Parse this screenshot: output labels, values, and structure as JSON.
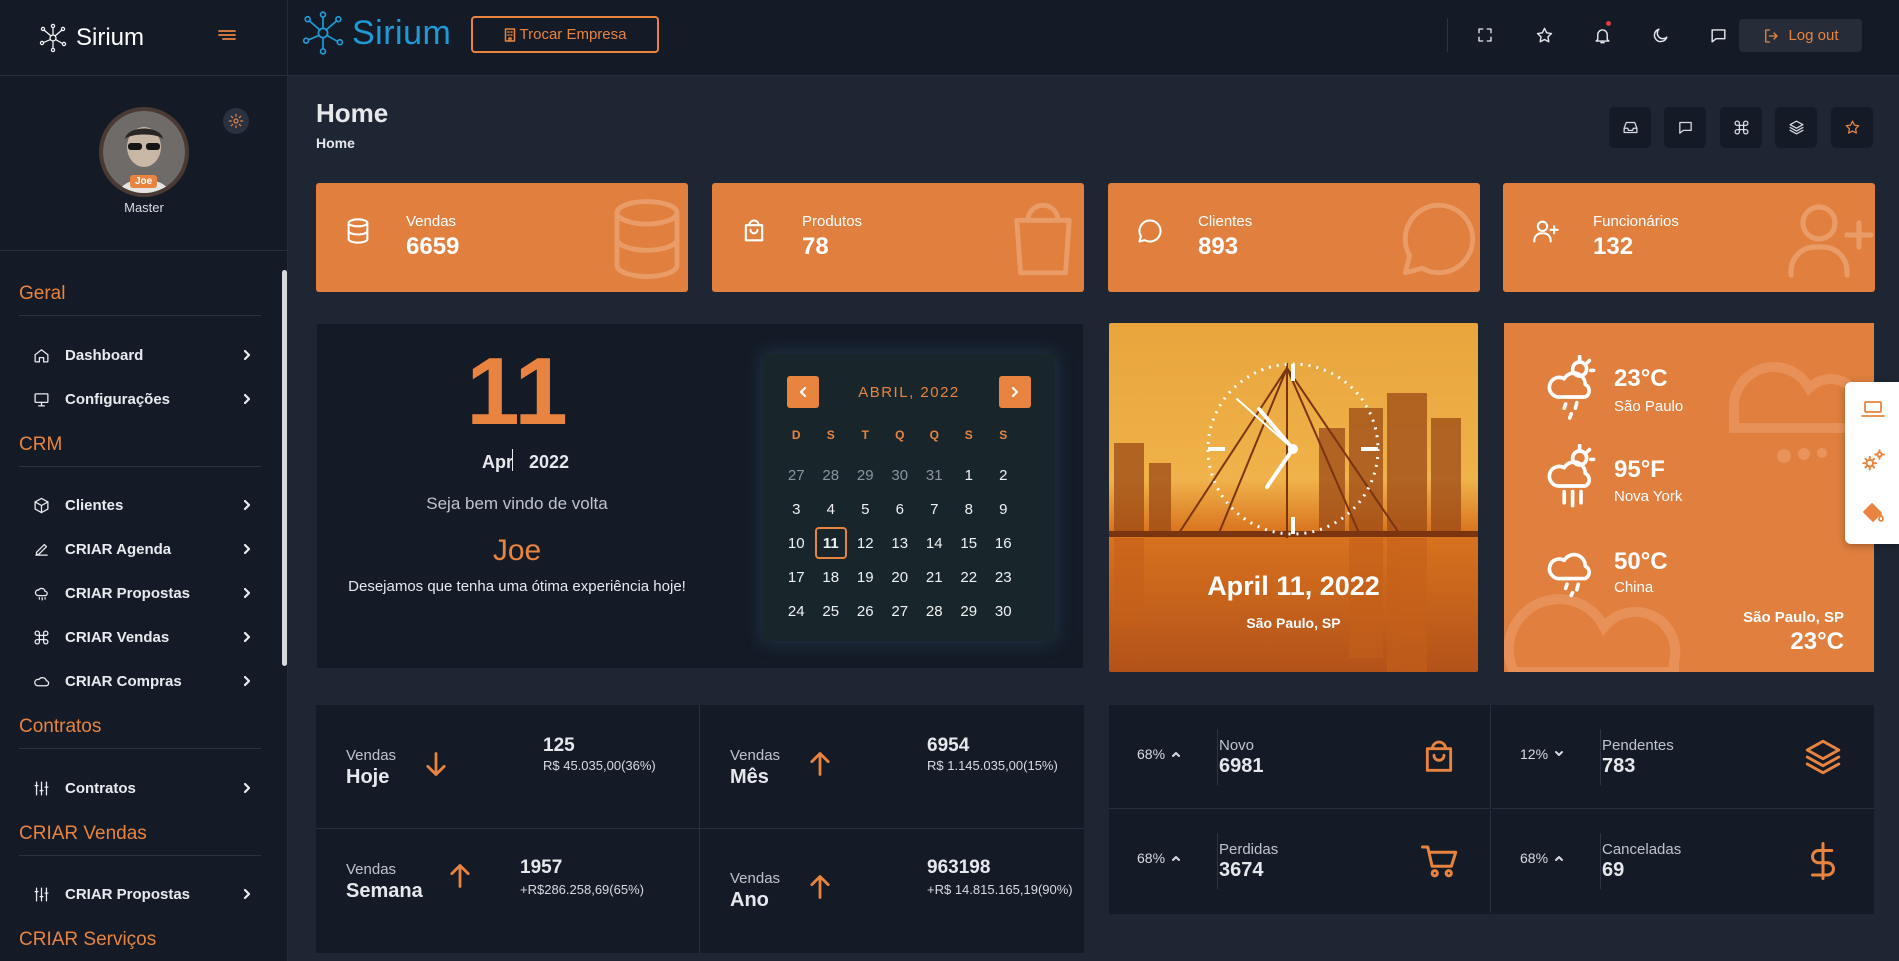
{
  "sidebar": {
    "brand": "Sirium",
    "profile": {
      "badge": "Joe",
      "role": "Master"
    },
    "sections": [
      {
        "title": "Geral",
        "items": [
          {
            "label": "Dashboard"
          },
          {
            "label": "Configurações"
          }
        ]
      },
      {
        "title": "CRM",
        "items": [
          {
            "label": "Clientes"
          },
          {
            "label": "CRIAR Agenda"
          },
          {
            "label": "CRIAR Propostas"
          },
          {
            "label": "CRIAR Vendas"
          },
          {
            "label": "CRIAR Compras"
          }
        ]
      },
      {
        "title": "Contratos",
        "items": [
          {
            "label": "Contratos"
          }
        ]
      },
      {
        "title": "CRIAR Vendas",
        "items": [
          {
            "label": "CRIAR Propostas"
          }
        ]
      },
      {
        "title": "CRIAR Serviços",
        "items": []
      }
    ]
  },
  "topbar": {
    "brand": "Sirium",
    "switch_company": "Trocar Empresa",
    "logout": "Log out",
    "icons": [
      "fullscreen-icon",
      "star-icon",
      "bell-icon",
      "moon-icon",
      "chat-icon"
    ]
  },
  "page": {
    "title": "Home",
    "breadcrumb": "Home"
  },
  "stats": [
    {
      "label": "Vendas",
      "value": "6659",
      "icon": "database-icon"
    },
    {
      "label": "Produtos",
      "value": "78",
      "icon": "shopping-bag-icon"
    },
    {
      "label": "Clientes",
      "value": "893",
      "icon": "chat-bubble-icon"
    },
    {
      "label": "Funcionários",
      "value": "132",
      "icon": "user-plus-icon"
    }
  ],
  "welcome": {
    "day": "11",
    "month": "Apr",
    "year": "2022",
    "greeting": "Seja bem vindo de volta",
    "name": "Joe",
    "message": "Desejamos que tenha uma ótima experiência hoje!"
  },
  "calendar": {
    "title": "ABRIL, 2022",
    "dow": [
      "D",
      "S",
      "T",
      "Q",
      "Q",
      "S",
      "S"
    ],
    "days": [
      [
        "27",
        "28",
        "29",
        "30",
        "31",
        "1",
        "2"
      ],
      [
        "3",
        "4",
        "5",
        "6",
        "7",
        "8",
        "9"
      ],
      [
        "10",
        "11",
        "12",
        "13",
        "14",
        "15",
        "16"
      ],
      [
        "17",
        "18",
        "19",
        "20",
        "21",
        "22",
        "23"
      ],
      [
        "24",
        "25",
        "26",
        "27",
        "28",
        "29",
        "30"
      ]
    ],
    "muted": [
      "27",
      "28",
      "29",
      "30",
      "31"
    ],
    "today": "11"
  },
  "city_card": {
    "date": "April 11, 2022",
    "location": "São Paulo, SP"
  },
  "weather": {
    "items": [
      {
        "temp": "23°C",
        "city": "São Paulo"
      },
      {
        "temp": "95°F",
        "city": "Nova York"
      },
      {
        "temp": "50°C",
        "city": "China"
      }
    ],
    "current_location": "São Paulo, SP",
    "current_temp": "23°C"
  },
  "sales": [
    {
      "kicker": "Vendas",
      "period": "Hoje",
      "trend": "down",
      "count": "125",
      "money": "R$ 45.035,00(36%)"
    },
    {
      "kicker": "Vendas",
      "period": "Mês",
      "trend": "up",
      "count": "6954",
      "money": "R$ 1.145.035,00(15%)"
    },
    {
      "kicker": "Vendas",
      "period": "Semana",
      "trend": "up",
      "count": "1957",
      "money": "+R$286.258,69(65%)"
    },
    {
      "kicker": "Vendas",
      "period": "Ano",
      "trend": "up",
      "count": "963198",
      "money": "+R$ 14.815.165,19(90%)"
    }
  ],
  "orders": [
    {
      "pct": "68%",
      "dir": "up",
      "label": "Novo",
      "value": "6981",
      "icon": "bag-icon"
    },
    {
      "pct": "12%",
      "dir": "down",
      "label": "Pendentes",
      "value": "783",
      "icon": "layers-icon"
    },
    {
      "pct": "68%",
      "dir": "up",
      "label": "Perdidas",
      "value": "3674",
      "icon": "cart-icon"
    },
    {
      "pct": "68%",
      "dir": "up",
      "label": "Canceladas",
      "value": "69",
      "icon": "dollar-icon"
    }
  ],
  "colors": {
    "accent": "#e07f3e",
    "background": "#1e2633",
    "panel": "#141b27",
    "brand_blue": "#1f9ad6"
  }
}
